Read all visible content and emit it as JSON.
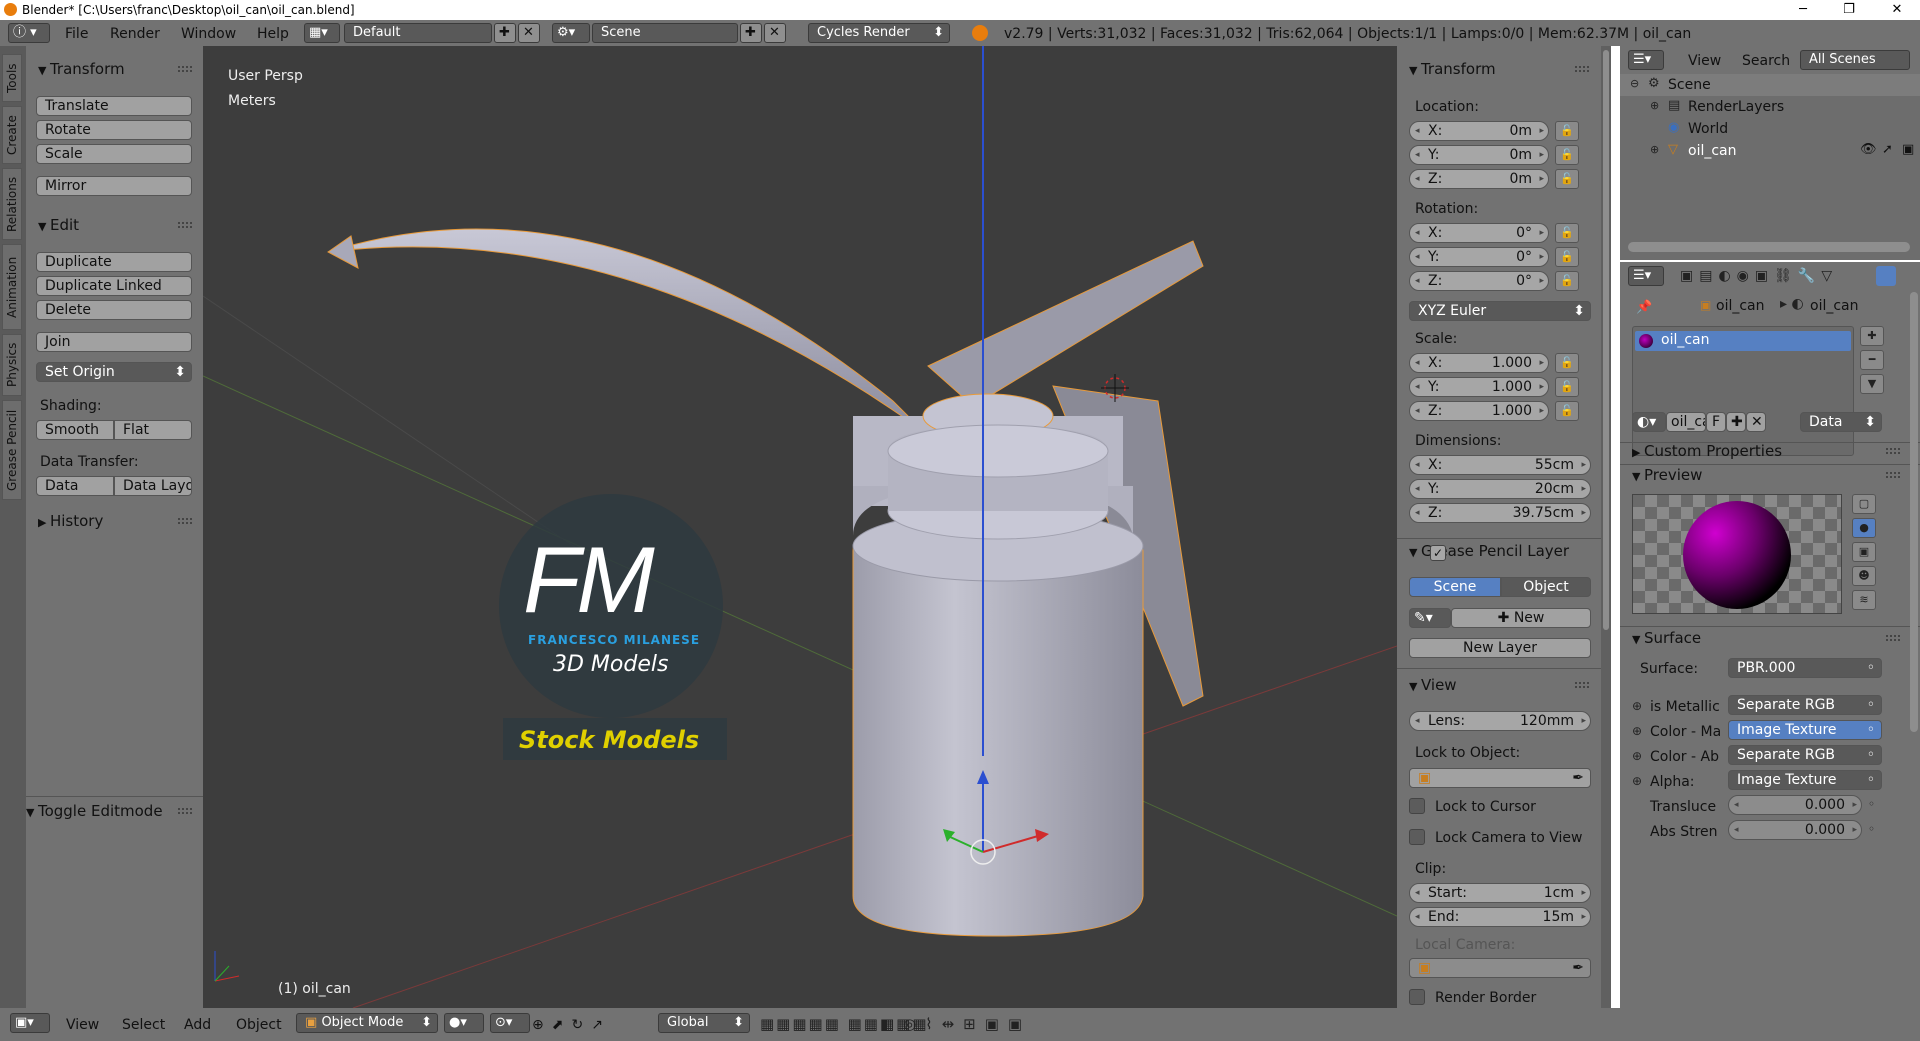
{
  "window": {
    "title": "Blender* [C:\\Users\\franc\\Desktop\\oil_can\\oil_can.blend]",
    "minimize": "─",
    "maximize": "❐",
    "close": "✕"
  },
  "topbar": {
    "menus": [
      "File",
      "Render",
      "Window",
      "Help"
    ],
    "layout": "Default",
    "scene": "Scene",
    "engine": "Cycles Render",
    "stats": "v2.79 | Verts:31,032 | Faces:31,032 | Tris:62,064 | Objects:1/1 | Lamps:0/0 | Mem:62.37M | oil_can"
  },
  "toolshelf": {
    "tabs": [
      "Tools",
      "Create",
      "Relations",
      "Animation",
      "Physics",
      "Grease Pencil"
    ],
    "transform_title": "Transform",
    "translate": "Translate",
    "rotate": "Rotate",
    "scale": "Scale",
    "mirror": "Mirror",
    "edit_title": "Edit",
    "duplicate": "Duplicate",
    "duplicate_linked": "Duplicate Linked",
    "delete": "Delete",
    "join": "Join",
    "set_origin": "Set Origin",
    "shading_label": "Shading:",
    "smooth": "Smooth",
    "flat": "Flat",
    "data_transfer_label": "Data Transfer:",
    "data": "Data",
    "data_layo": "Data Layo",
    "history_title": "History",
    "toggle_editmode": "Toggle Editmode"
  },
  "viewport": {
    "view_label": "User Persp",
    "units_label": "Meters",
    "object_label": "(1) oil_can",
    "watermark": {
      "fm": "FM",
      "name": "FRANCESCO MILANESE",
      "sub": "3D Models",
      "stock": "Stock Models"
    }
  },
  "properties_n": {
    "transform_title": "Transform",
    "location_label": "Location:",
    "location": {
      "x": "0m",
      "y": "0m",
      "z": "0m"
    },
    "rotation_label": "Rotation:",
    "rotation": {
      "x": "0°",
      "y": "0°",
      "z": "0°"
    },
    "rotation_mode": "XYZ Euler",
    "scale_label": "Scale:",
    "scale": {
      "x": "1.000",
      "y": "1.000",
      "z": "1.000"
    },
    "dimensions_label": "Dimensions:",
    "dimensions": {
      "x": "55cm",
      "y": "20cm",
      "z": "39.75cm"
    },
    "axis": {
      "x": "X:",
      "y": "Y:",
      "z": "Z:"
    },
    "gp_title": "Grease Pencil Layer",
    "gp_scene": "Scene",
    "gp_object": "Object",
    "gp_new": "New",
    "gp_new_layer": "New Layer",
    "view_title": "View",
    "lens_label": "Lens:",
    "lens_value": "120mm",
    "lock_to_object": "Lock to Object:",
    "lock_to_cursor": "Lock to Cursor",
    "lock_camera": "Lock Camera to View",
    "clip_label": "Clip:",
    "clip_start_label": "Start:",
    "clip_start": "1cm",
    "clip_end_label": "End:",
    "clip_end": "15m",
    "local_camera": "Local Camera:",
    "render_border": "Render Border"
  },
  "outliner": {
    "view": "View",
    "search": "Search",
    "filter": "All Scenes",
    "items": [
      "Scene",
      "RenderLayers",
      "World",
      "oil_can"
    ]
  },
  "properties": {
    "breadcrumb": [
      "oil_can",
      "oil_can"
    ],
    "material_slot": "oil_can",
    "material_name": "oil_ca",
    "material_f": "F",
    "data_dropdown": "Data",
    "custom_props": "Custom Properties",
    "preview": "Preview",
    "surface_title": "Surface",
    "surface_label": "Surface:",
    "surface_value": "PBR.000",
    "rows": [
      {
        "label": "is Metallic",
        "value": "Separate RGB"
      },
      {
        "label": "Color - Ma",
        "value": "Image Texture"
      },
      {
        "label": "Color - Ab",
        "value": "Separate RGB"
      },
      {
        "label": "Alpha:",
        "value": "Image Texture"
      }
    ],
    "translucent_label": "Transluce",
    "translucent_value": "0.000",
    "abs_label": "Abs Stren",
    "abs_value": "0.000"
  },
  "bottombar": {
    "menus": [
      "View",
      "Select",
      "Add",
      "Object"
    ],
    "mode": "Object Mode",
    "orientation": "Global"
  }
}
